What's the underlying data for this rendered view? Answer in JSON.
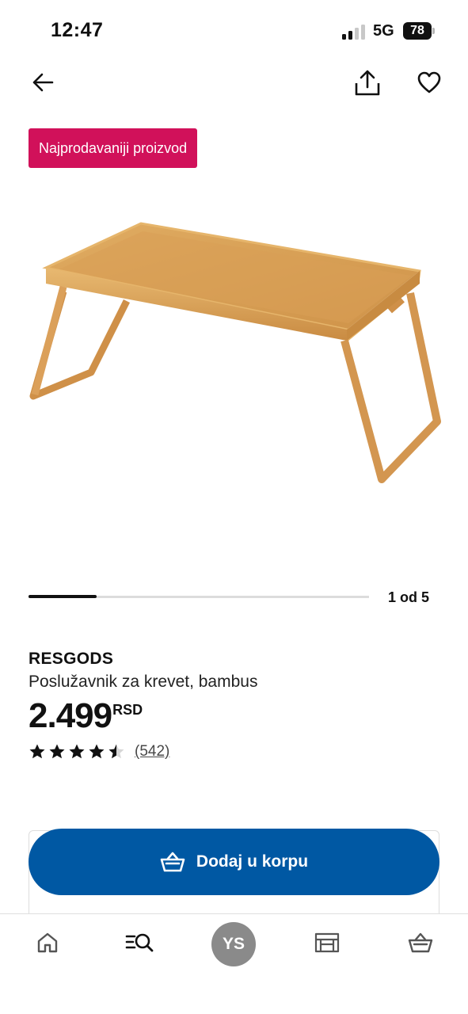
{
  "status_bar": {
    "time": "12:47",
    "network": "5G",
    "battery": "78"
  },
  "header": {
    "back_icon": "arrow-left-icon",
    "share_icon": "share-icon",
    "favorite_icon": "heart-icon"
  },
  "badge": {
    "label": "Najprodavaniji proizvod",
    "color": "#d1115a"
  },
  "gallery": {
    "counter": "1 od 5",
    "current": 1,
    "total": 5,
    "progress": 0.2
  },
  "product": {
    "name": "RESGODS",
    "description": "Poslužavnik za krevet, bambus",
    "price": "2.499",
    "currency": "RSD",
    "rating": 4.5,
    "rating_max": 5,
    "reviews": "(542)"
  },
  "cta": {
    "label": "Dodaj u korpu",
    "icon": "shopping-basket-icon",
    "color": "#0058a3"
  },
  "bottom_nav": {
    "home_icon": "home-icon",
    "search_icon": "search-list-icon",
    "profile_initials": "YS",
    "store_icon": "store-icon",
    "cart_icon": "shopping-basket-icon"
  }
}
